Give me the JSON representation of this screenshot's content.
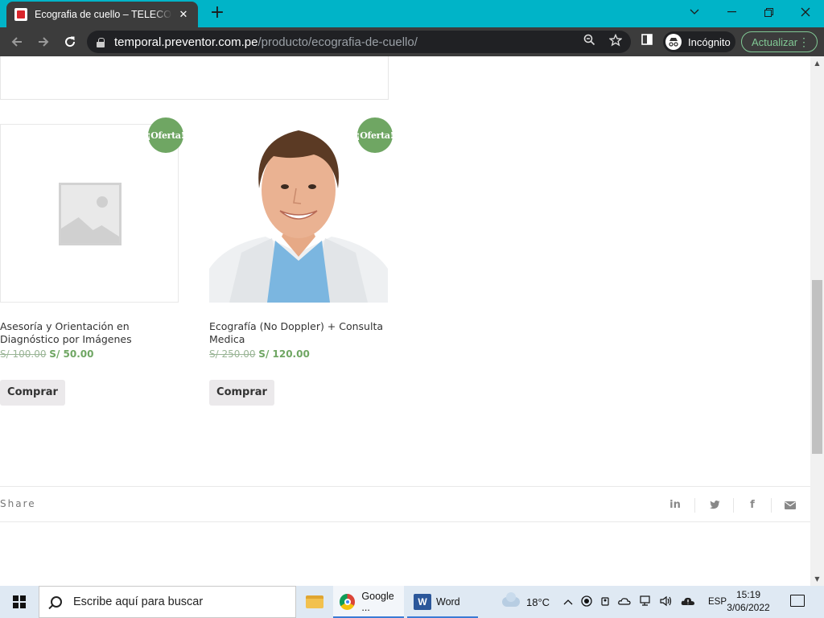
{
  "browser": {
    "tab_title": "Ecografia de cuello – TELECONSULTA",
    "tab_close": "✕",
    "new_tab": "+",
    "url_host": "temporal.preventor.com.pe",
    "url_path": "/producto/ecografia-de-cuello/",
    "incognito_label": "Incógnito",
    "update_label": "Actualizar"
  },
  "products": [
    {
      "badge": "¡Oferta!",
      "name": "Asesoría y Orientación en Diagnóstico por Imágenes",
      "old_price": "S/ 100.00",
      "new_price": "S/ 50.00",
      "button": "Comprar"
    },
    {
      "badge": "¡Oferta!",
      "name": "Ecografía (No Doppler) + Consulta Medica",
      "old_price": "S/ 250.00",
      "new_price": "S/ 120.00",
      "button": "Comprar"
    }
  ],
  "share": {
    "label": "Share",
    "icons": [
      "linkedin-icon",
      "twitter-icon",
      "facebook-icon",
      "email-icon"
    ]
  },
  "taskbar": {
    "search_placeholder": "Escribe aquí para buscar",
    "apps": [
      {
        "label": "Google ..."
      },
      {
        "label": "Word"
      }
    ],
    "weather": "18°C",
    "language": "ESP",
    "time": "15:19",
    "date": "3/06/2022"
  },
  "colors": {
    "tabbar": "#00b4c8",
    "badge": "#6fa663",
    "price_new": "#6fa663"
  }
}
